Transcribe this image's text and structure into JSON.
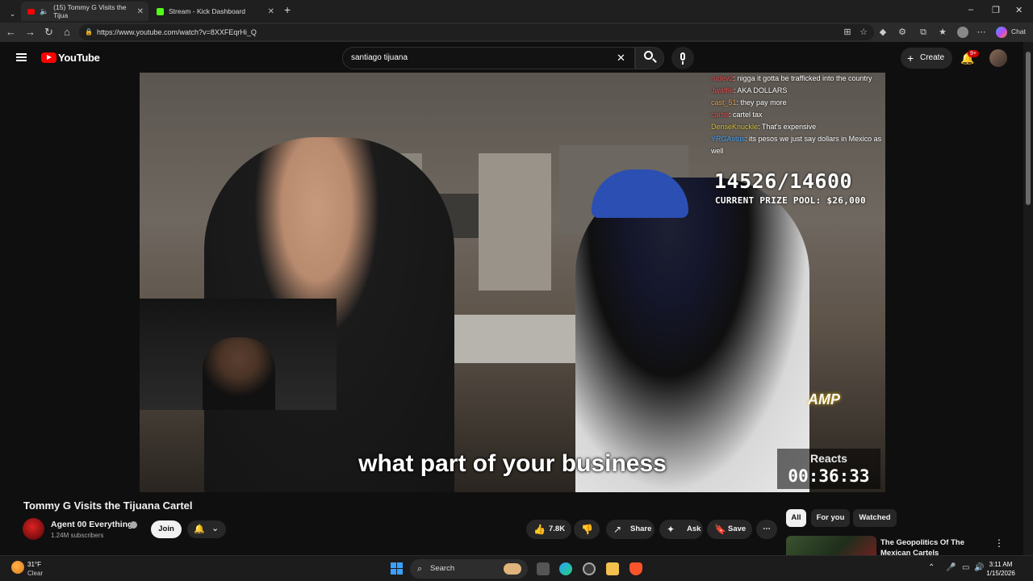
{
  "browser": {
    "tabs": [
      {
        "label": "(15) Tommy G Visits the Tijua"
      },
      {
        "label": "Stream - Kick Dashboard"
      }
    ],
    "url": "https://www.youtube.com/watch?v=8XXFEqrHi_Q",
    "chat_button": "Chat"
  },
  "header": {
    "brand": "YouTube",
    "search_value": "santiago tijuana",
    "create_label": "Create",
    "notifications_badge": "9+"
  },
  "video": {
    "chat": [
      {
        "user": "rudev2",
        "text": "nigga it gotta be trafficked into the country"
      },
      {
        "user": "Jwaffle",
        "text": "AKA DOLLARS"
      },
      {
        "user": "cast_51",
        "text": "they pay more"
      },
      {
        "user": "cartel",
        "text": "cartel tax"
      },
      {
        "user": "DenseKnuckle",
        "text": "That's expensive"
      },
      {
        "user": "YRGAstus",
        "text": "its pesos we just say dollars in Mexico as well"
      }
    ],
    "counter": "14526/14600",
    "prize_pool": "CURRENT PRIZE POOL: $26,000",
    "amp_logo": "AMP",
    "reacts_label": "Reacts",
    "timer": "00:36:33",
    "caption": "what part of your business"
  },
  "details": {
    "title": "Tommy G Visits the Tijuana Cartel",
    "channel_name": "Agent 00 Everything",
    "subscribers": "1.24M subscribers",
    "join_label": "Join",
    "likes": "7.8K",
    "share_label": "Share",
    "ask_label": "Ask",
    "save_label": "Save"
  },
  "sidebar": {
    "chips": [
      "All",
      "For you",
      "Watched"
    ],
    "recommendation_title": "The Geopolitics Of The Mexican Cartels"
  },
  "taskbar": {
    "temperature": "31°F",
    "weather": "Clear",
    "search_label": "Search",
    "time": "3:11 AM",
    "date": "1/15/2026"
  }
}
